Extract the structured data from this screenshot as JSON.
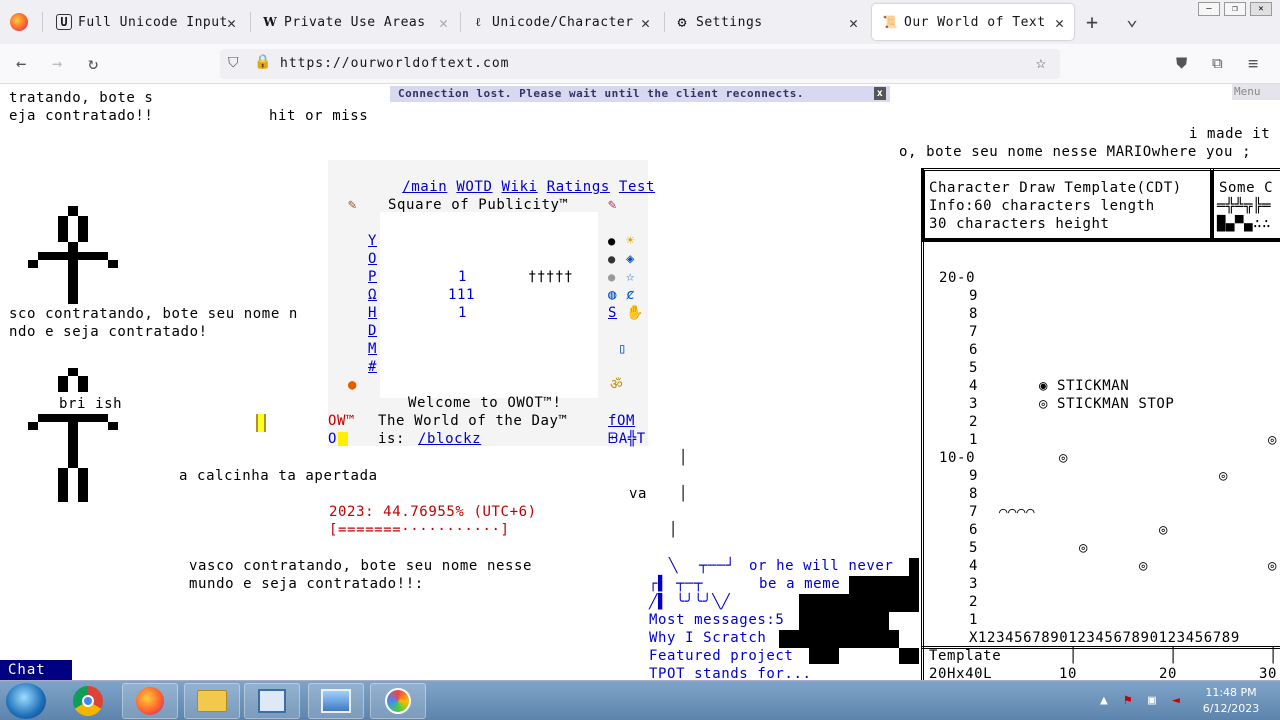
{
  "browser": {
    "tabs": [
      {
        "label": "Full Unicode Input",
        "icon": "u-icon"
      },
      {
        "label": "Private Use Areas",
        "icon": "w-icon"
      },
      {
        "label": "Unicode/Character",
        "icon": "feather-icon"
      },
      {
        "label": "Settings",
        "icon": "gear-icon"
      },
      {
        "label": "Our World of Text",
        "icon": "scroll-icon"
      }
    ],
    "url": "https://ourworldoftext.com",
    "new_tab": "+",
    "list_tabs": "⌄"
  },
  "page": {
    "notice": "Connection lost. Please wait until the client reconnects.",
    "notice_close": "x",
    "menu": "Menu",
    "chat": "Chat",
    "texts": {
      "t1": "tratando, bote s",
      "t2": "eja contratado!!",
      "t3": "hit or miss",
      "t4": "i made it",
      "t5": "o, bote seu nome nesse MARIOwhere you ;",
      "t6": "sco contratando, bote seu nome n",
      "t7": "ndo e seja contratado!",
      "t8": "bri ish",
      "t9": "a calcinha ta apertada",
      "t10": "va",
      "t11": "vasco contratando, bote seu nome nesse",
      "t12": "mundo e seja contratado!!:",
      "t13": "or he will never",
      "t14": "be a meme",
      "t15": "Most messages:5",
      "t16": "Why I Scratch",
      "t17": "Featured project",
      "t18": "TPOT stands for..."
    },
    "publicity": {
      "links": [
        "/main",
        "WOTD",
        "Wiki",
        "Ratings",
        "Test"
      ],
      "title": "Square of Publicity™",
      "left_col": [
        "Y",
        "O",
        "P",
        "Ω",
        "H",
        "D",
        "M",
        "#"
      ],
      "nums": [
        "1",
        "111",
        "1"
      ],
      "daggers": "†††††",
      "right_col_link": "S",
      "welcome": "Welcome to OWOT™!",
      "wotd_label": "The World of the Day™",
      "wotd_is": "is:",
      "wotd_link": "/blockz",
      "ow": "OW™",
      "o": "O",
      "fom": "fOM",
      "bottom_right": "ᗸA╬T",
      "year_line": "2023: 44.76955% (UTC+6)",
      "progress_bar": "[=======···········]",
      "progress": 0.4477
    },
    "cdt": {
      "header1": "Character Draw Template(CDT)",
      "header2": "Info:60 characters length",
      "header3": "30 characters height",
      "side_title": "Some C",
      "y_labels": [
        "20-0",
        "9",
        "8",
        "7",
        "6",
        "5",
        "4",
        "3",
        "2",
        "1",
        "10-0",
        "9",
        "8",
        "7",
        "6",
        "5",
        "4",
        "3",
        "2",
        "1"
      ],
      "legend1": "◉ STICKMAN",
      "legend2": "◎ STICKMAN STOP",
      "x_axis": "X12345678901234567890123456789",
      "template": "Template",
      "size": "20Hx40L",
      "tick10": "10",
      "tick20": "20",
      "tick30": "30"
    }
  },
  "taskbar": {
    "time": "11:48 PM",
    "date": "6/12/2023"
  }
}
